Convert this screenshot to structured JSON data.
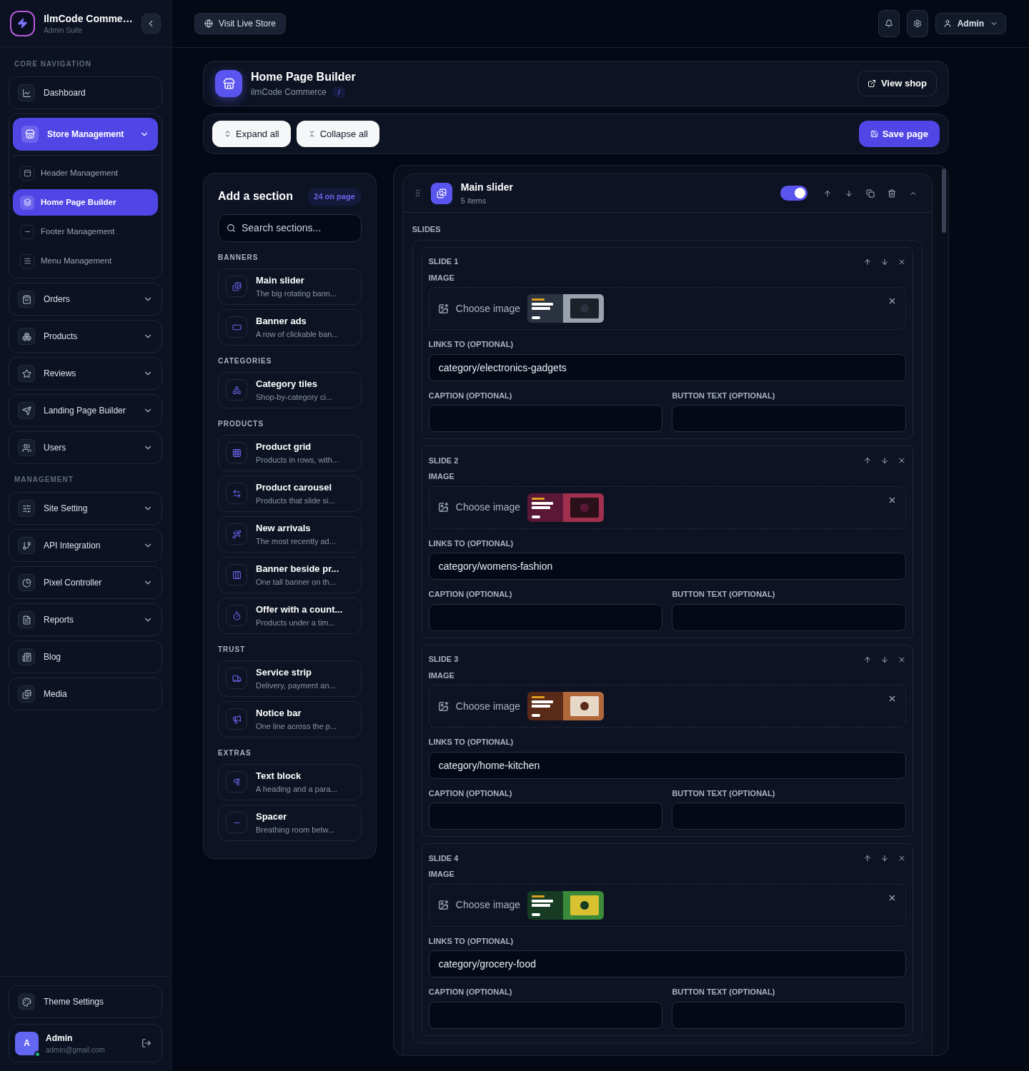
{
  "sidebar": {
    "brand": {
      "title": "IlmCode Comme…",
      "subtitle": "Admin Suite"
    },
    "sections": [
      {
        "title": "CORE NAVIGATION",
        "items": [
          {
            "label": "Dashboard",
            "selected": false
          },
          {
            "label": "Store Management",
            "selected": true,
            "expanded": true,
            "children": [
              {
                "label": "Header Management",
                "selected": false
              },
              {
                "label": "Home Page Builder",
                "selected": true
              },
              {
                "label": "Footer Management",
                "selected": false
              },
              {
                "label": "Menu Management",
                "selected": false
              }
            ]
          },
          {
            "label": "Orders",
            "selected": false,
            "expanded": false
          },
          {
            "label": "Products",
            "selected": false,
            "expanded": false
          },
          {
            "label": "Reviews",
            "selected": false,
            "expanded": false
          },
          {
            "label": "Landing Page Builder",
            "selected": false,
            "expanded": false
          },
          {
            "label": "Users",
            "selected": false,
            "expanded": false
          }
        ]
      },
      {
        "title": "MANAGEMENT",
        "items": [
          {
            "label": "Site Setting",
            "selected": false,
            "expanded": false
          },
          {
            "label": "API Integration",
            "selected": false,
            "expanded": false
          },
          {
            "label": "Pixel Controller",
            "selected": false,
            "expanded": false
          },
          {
            "label": "Reports",
            "selected": false,
            "expanded": false
          },
          {
            "label": "Blog",
            "selected": false
          },
          {
            "label": "Media",
            "selected": false
          }
        ]
      }
    ],
    "theme_settings": "Theme Settings",
    "user": {
      "initial": "A",
      "name": "Admin",
      "email": "admin@gmail.com",
      "online": true
    }
  },
  "topbar": {
    "visit_store": "Visit Live Store",
    "account": "Admin"
  },
  "page_header": {
    "title": "Home Page Builder",
    "breadcrumb": "ilmCode Commerce",
    "separator": "/",
    "view_shop": "View shop"
  },
  "toolbar": {
    "expand_all": "Expand all",
    "collapse_all": "Collapse all",
    "save": "Save page"
  },
  "add_section": {
    "title": "Add a section",
    "count": "24 on page",
    "search_placeholder": "Search sections...",
    "groups": [
      {
        "title": "BANNERS",
        "items": [
          {
            "title": "Main slider",
            "description": "The big rotating bann..."
          },
          {
            "title": "Banner ads",
            "description": "A row of clickable ban..."
          }
        ]
      },
      {
        "title": "CATEGORIES",
        "items": [
          {
            "title": "Category tiles",
            "description": "Shop-by-category ci..."
          }
        ]
      },
      {
        "title": "PRODUCTS",
        "items": [
          {
            "title": "Product grid",
            "description": "Products in rows, with..."
          },
          {
            "title": "Product carousel",
            "description": "Products that slide si..."
          },
          {
            "title": "New arrivals",
            "description": "The most recently ad..."
          },
          {
            "title": "Banner beside pr...",
            "description": "One tall banner on th..."
          },
          {
            "title": "Offer with a count...",
            "description": "Products under a tim..."
          }
        ]
      },
      {
        "title": "TRUST",
        "items": [
          {
            "title": "Service strip",
            "description": "Delivery, payment an..."
          },
          {
            "title": "Notice bar",
            "description": "One line across the p..."
          }
        ]
      },
      {
        "title": "EXTRAS",
        "items": [
          {
            "title": "Text block",
            "description": "A heading and a para..."
          },
          {
            "title": "Spacer",
            "description": "Breathing room betw..."
          }
        ]
      }
    ]
  },
  "block": {
    "title": "Main slider",
    "subtitle": "5 items",
    "on": true,
    "expanded": true,
    "slides_label": "SLIDES",
    "slides": [
      {
        "label": "SLIDE 1",
        "image_label": "IMAGE",
        "choose_image": "Choose image",
        "links_label": "LINKS TO (OPTIONAL)",
        "link": "category/electronics-gadgets",
        "caption_label": "CAPTION (OPTIONAL)",
        "button_label": "BUTTON TEXT (OPTIONAL)"
      },
      {
        "label": "SLIDE 2",
        "image_label": "IMAGE",
        "choose_image": "Choose image",
        "links_label": "LINKS TO (OPTIONAL)",
        "link": "category/womens-fashion",
        "caption_label": "CAPTION (OPTIONAL)",
        "button_label": "BUTTON TEXT (OPTIONAL)"
      },
      {
        "label": "SLIDE 3",
        "image_label": "IMAGE",
        "choose_image": "Choose image",
        "links_label": "LINKS TO (OPTIONAL)",
        "link": "category/home-kitchen",
        "caption_label": "CAPTION (OPTIONAL)",
        "button_label": "BUTTON TEXT (OPTIONAL)"
      },
      {
        "label": "SLIDE 4",
        "image_label": "IMAGE",
        "choose_image": "Choose image",
        "links_label": "LINKS TO (OPTIONAL)",
        "link": "category/grocery-food",
        "caption_label": "CAPTION (OPTIONAL)",
        "button_label": "BUTTON TEXT (OPTIONAL)"
      }
    ]
  }
}
